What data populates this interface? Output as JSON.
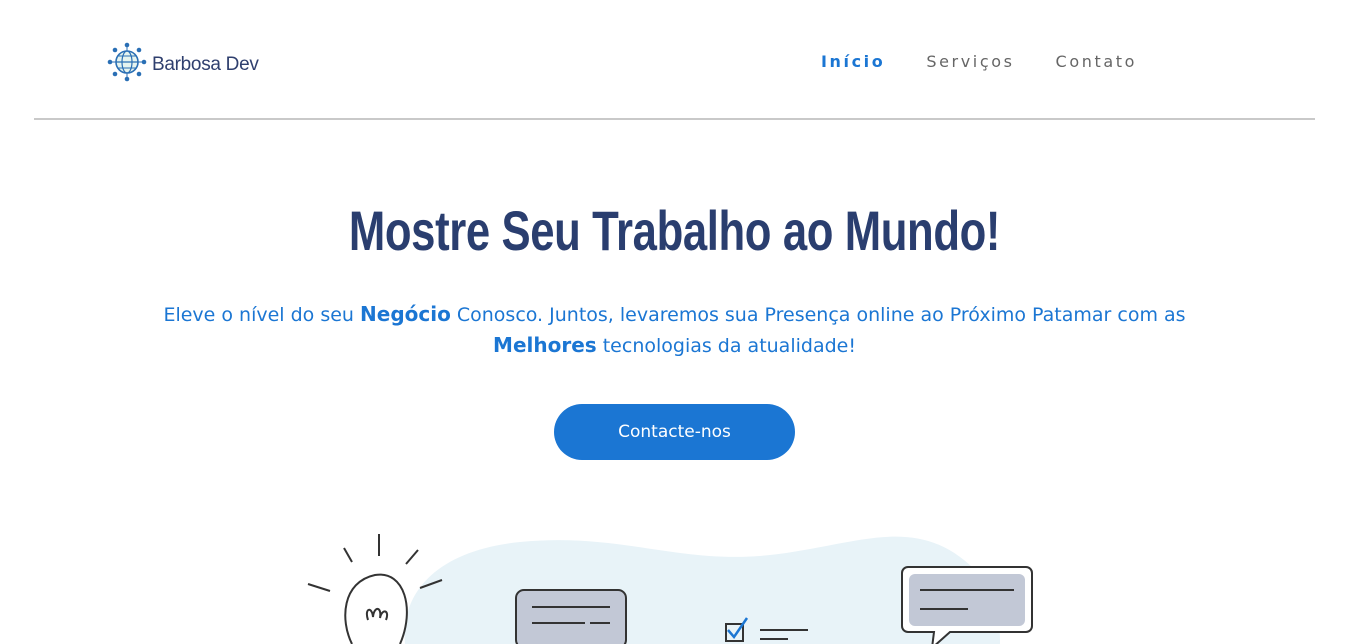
{
  "brand": {
    "name": "Barbosa Dev",
    "logo_icon": "globe-network-icon"
  },
  "nav": {
    "items": [
      {
        "label": "Início",
        "active": true
      },
      {
        "label": "Serviços",
        "active": false
      },
      {
        "label": "Contato",
        "active": false
      }
    ]
  },
  "hero": {
    "title": "Mostre Seu Trabalho ao Mundo!",
    "text_part1": "Eleve o nível do seu ",
    "text_bold1": "Negócio",
    "text_part2": " Conosco. Juntos, levaremos sua Presença online ao Próximo Patamar com as ",
    "text_bold2": "Melhores",
    "text_part3": " tecnologias da atualidade!",
    "cta_label": "Contacte-nos"
  },
  "colors": {
    "accent": "#1b76d3",
    "title": "#2a3e6f",
    "nav_inactive": "#666666",
    "blob": "#e8f3f8",
    "bubble": "#c2c8d6"
  }
}
